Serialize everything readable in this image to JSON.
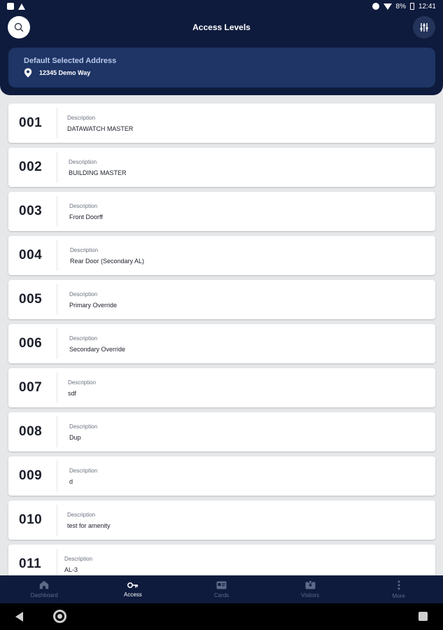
{
  "status_bar": {
    "icons": [
      "photo-icon",
      "warning-icon",
      "dnd-icon",
      "wifi-icon",
      "battery-icon"
    ],
    "battery": "8%",
    "time": "12:41"
  },
  "header": {
    "title": "Access Levels",
    "search_icon": "search-icon",
    "filter_icon": "filter-sliders-icon",
    "address_label": "Default Selected Address",
    "address_value": "12345 Demo Way",
    "address_icon": "location-pin-icon"
  },
  "list": {
    "description_label": "Description",
    "items": [
      {
        "code": "001",
        "label": "Description",
        "description": "DATAWATCH MASTER"
      },
      {
        "code": "002",
        "label": "Description",
        "description": "BUILDING MASTER"
      },
      {
        "code": "003",
        "label": "Description",
        "description": "Front Doorff"
      },
      {
        "code": "004",
        "label": "Description",
        "description": "Rear Door (Secondary AL)"
      },
      {
        "code": "005",
        "label": "Description",
        "description": "Primary Override"
      },
      {
        "code": "006",
        "label": "Description",
        "description": "Secondary Override"
      },
      {
        "code": "007",
        "label": "Description",
        "description": "sdf"
      },
      {
        "code": "008",
        "label": "Description",
        "description": "Dup"
      },
      {
        "code": "009",
        "label": "Description",
        "description": "d"
      },
      {
        "code": "010",
        "label": "Description",
        "description": "test for amenity"
      },
      {
        "code": "011",
        "label": "Description",
        "description": "AL-3"
      }
    ]
  },
  "bottom_nav": {
    "items": [
      {
        "label": "Dashboard",
        "icon": "home-icon",
        "active": false
      },
      {
        "label": "Access",
        "icon": "key-icon",
        "active": true
      },
      {
        "label": "Cards",
        "icon": "id-card-icon",
        "active": false
      },
      {
        "label": "Visitors",
        "icon": "badge-icon",
        "active": false
      },
      {
        "label": "More",
        "icon": "more-vertical-icon",
        "active": false
      }
    ]
  },
  "colors": {
    "header_bg": "#0e1b3d",
    "address_card_bg": "#1e3565",
    "page_bg": "#e6e7e9",
    "nav_inactive": "#5d6a88",
    "nav_active": "#ffffff"
  }
}
